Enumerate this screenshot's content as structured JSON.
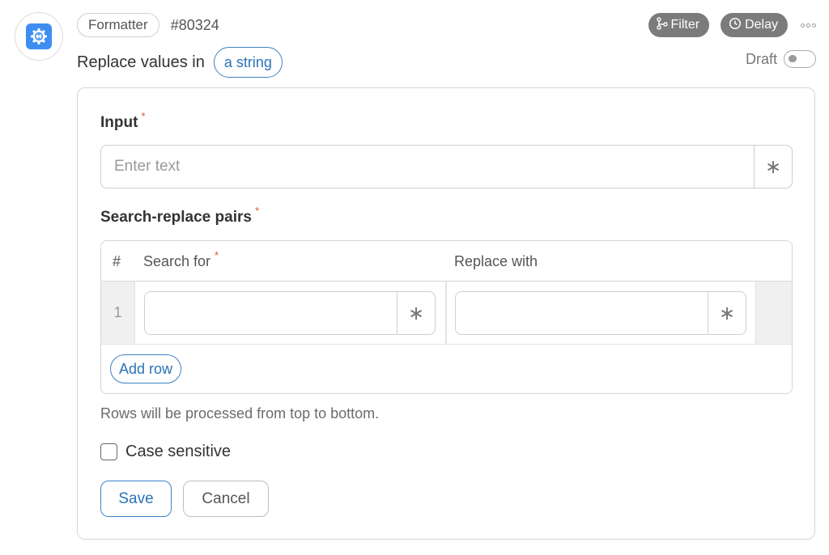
{
  "step": {
    "app_badge": "Formatter",
    "id": "#80324",
    "title": "Replace values in",
    "type_pill": "a string",
    "icon": "gear-refresh-icon",
    "accent_color": "#3d8ef0"
  },
  "header_actions": {
    "filter_label": "Filter",
    "delay_label": "Delay",
    "draft_label": "Draft",
    "draft_enabled": false
  },
  "form": {
    "input": {
      "label": "Input",
      "required_mark": "*",
      "placeholder": "Enter text",
      "value": "",
      "addon": "∗"
    },
    "pairs": {
      "label": "Search-replace pairs",
      "required_mark": "*",
      "columns": {
        "num": "#",
        "search": "Search for",
        "search_required_mark": "*",
        "replace": "Replace with"
      },
      "rows": [
        {
          "num": "1",
          "search": "",
          "replace": "",
          "search_addon": "∗",
          "replace_addon": "∗"
        }
      ],
      "add_row_label": "Add row"
    },
    "hint": "Rows will be processed from top to bottom.",
    "case_sensitive": {
      "label": "Case sensitive",
      "checked": false
    },
    "save_label": "Save",
    "cancel_label": "Cancel"
  }
}
